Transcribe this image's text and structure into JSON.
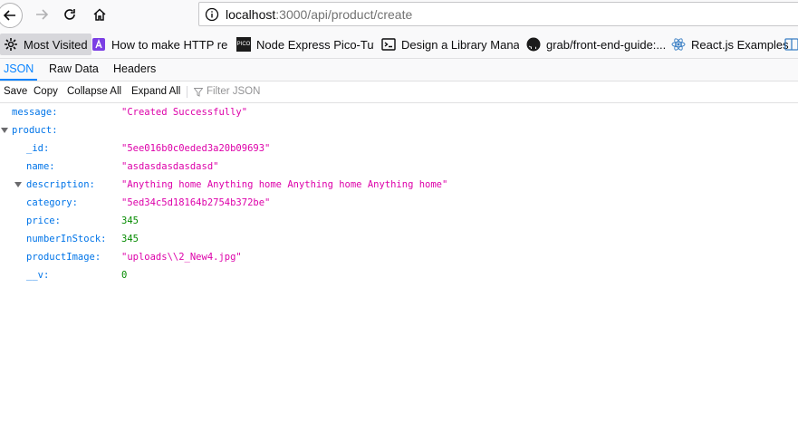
{
  "browser": {
    "url_host": "localhost",
    "url_rest": ":3000/api/product/create"
  },
  "bookmarks": [
    {
      "label": "Most Visited",
      "icon": "gear-icon"
    },
    {
      "label": "How to make HTTP re...",
      "icon": "purple-bookmark-icon"
    },
    {
      "label": "Node Express Pico-Tut...",
      "icon": "pico-icon"
    },
    {
      "label": "Design a Library Mana...",
      "icon": "terminal-icon"
    },
    {
      "label": "grab/front-end-guide:...",
      "icon": "github-icon"
    },
    {
      "label": "React.js Examples",
      "icon": "react-icon"
    }
  ],
  "viewer": {
    "tabs": [
      "JSON",
      "Raw Data",
      "Headers"
    ],
    "toolbar": {
      "save": "Save",
      "copy": "Copy",
      "collapse_all": "Collapse All",
      "expand_all": "Expand All",
      "filter_placeholder": "Filter JSON"
    }
  },
  "json": {
    "message_key": "message:",
    "message_val": "\"Created Successfully\"",
    "product_key": "product:",
    "id_key": "_id:",
    "id_val": "\"5ee016b0c0eded3a20b09693\"",
    "name_key": "name:",
    "name_val": "\"asdasdasdasdasd\"",
    "description_key": "description:",
    "description_val": "\"Anything home Anything home Anything home Anything home\"",
    "category_key": "category:",
    "category_val": "\"5ed34c5d18164b2754b372be\"",
    "price_key": "price:",
    "price_val": "345",
    "stock_key": "numberInStock:",
    "stock_val": "345",
    "image_key": "productImage:",
    "image_val": "\"uploads\\\\2_New4.jpg\"",
    "v_key": "__v:",
    "v_val": "0"
  },
  "colors": {
    "accent": "#0a84ff",
    "json_key": "#0074e8",
    "json_string": "#dd00a9",
    "json_number": "#058b00"
  }
}
